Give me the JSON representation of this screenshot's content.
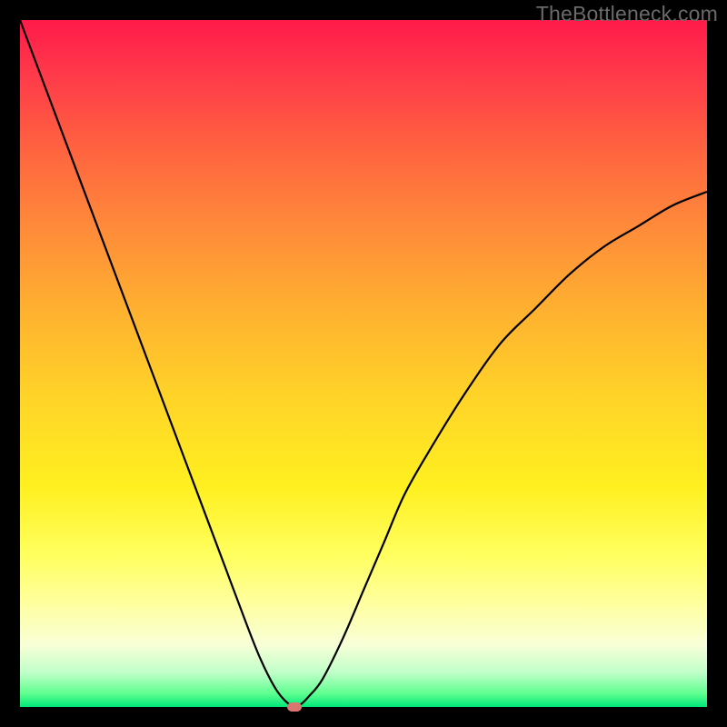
{
  "watermark": "TheBottleneck.com",
  "chart_data": {
    "type": "line",
    "title": "",
    "xlabel": "",
    "ylabel": "",
    "xlim": [
      0,
      100
    ],
    "ylim": [
      0,
      100
    ],
    "x": [
      0,
      3,
      6,
      9,
      12,
      15,
      18,
      21,
      24,
      27,
      30,
      33,
      35,
      37,
      38.5,
      40,
      41,
      42,
      44,
      47,
      50,
      53,
      56,
      60,
      65,
      70,
      75,
      80,
      85,
      90,
      95,
      100
    ],
    "values": [
      100,
      92,
      84,
      76,
      68,
      60,
      52,
      44,
      36,
      28,
      20,
      12,
      7,
      3,
      1,
      0,
      0.5,
      1.5,
      4,
      10,
      17,
      24,
      31,
      38,
      46,
      53,
      58,
      63,
      67,
      70,
      73,
      75
    ],
    "optimum_x": 40,
    "optimum_y": 0,
    "grid": false
  },
  "colors": {
    "curve": "#000000",
    "dot": "#d9766f",
    "background_top": "#ff1a4a",
    "background_bottom": "#00e87a",
    "frame": "#000000"
  }
}
